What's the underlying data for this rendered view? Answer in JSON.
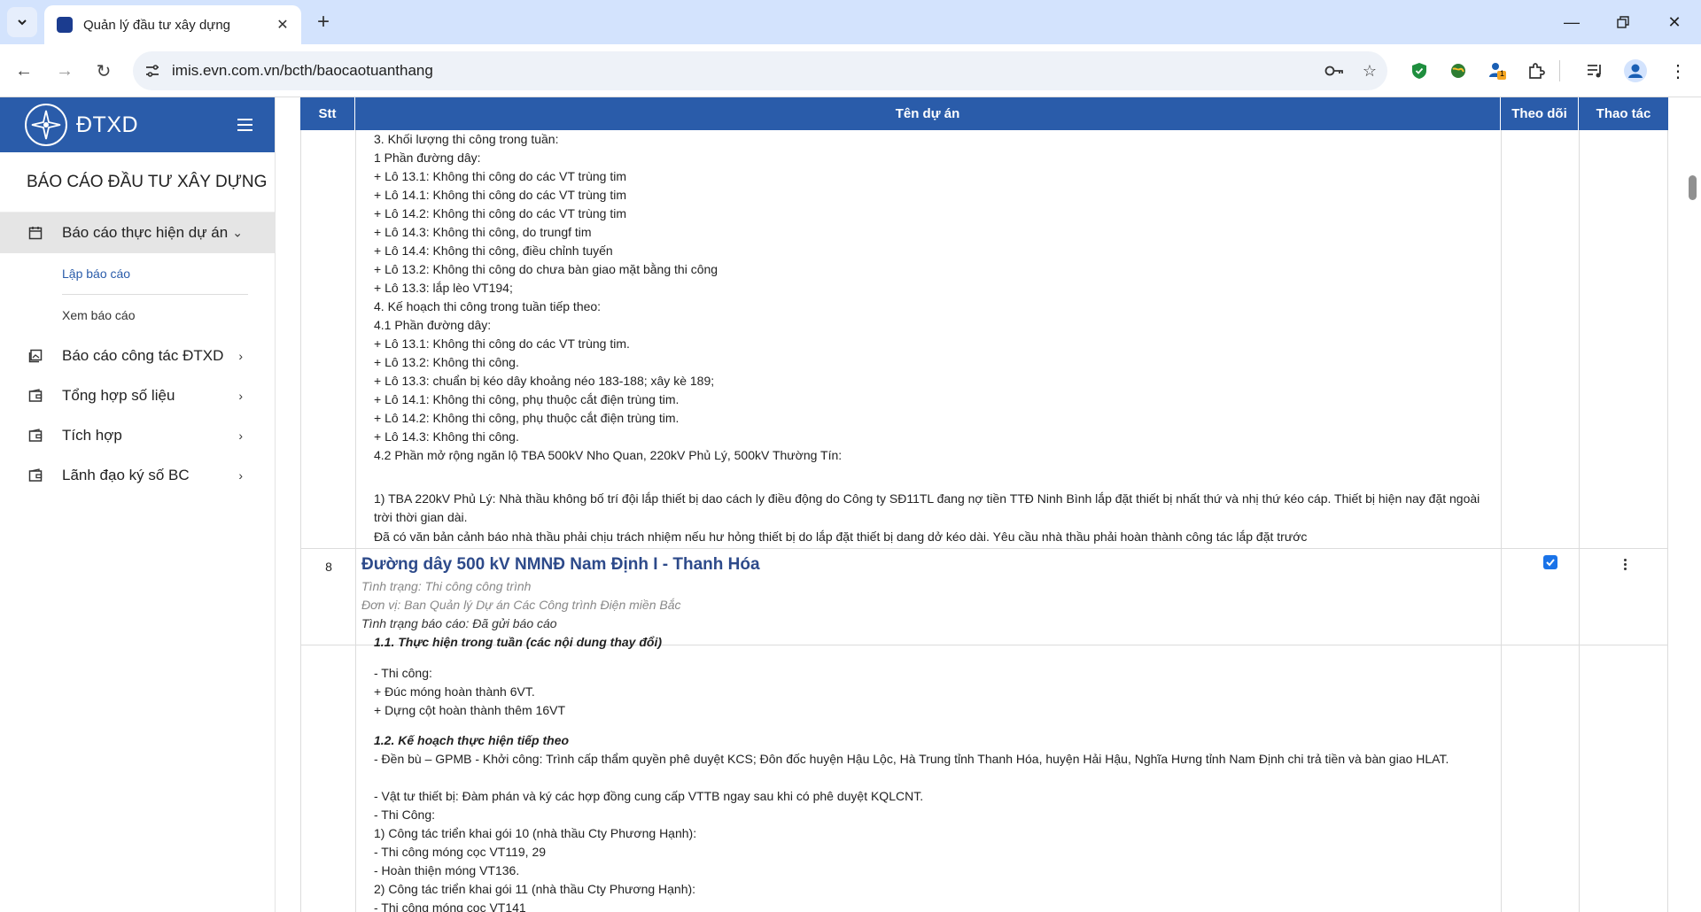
{
  "browser": {
    "tab_title": "Quản lý đầu tư xây dựng",
    "url": "imis.evn.com.vn/bcth/baocaotuanthang",
    "extension_badge": "1"
  },
  "sidebar": {
    "brand": "ĐTXD",
    "title": "BÁO CÁO ĐẦU TƯ XÂY DỰNG",
    "items": [
      {
        "label": "Báo cáo thực hiện dự án",
        "icon": "calendar-icon"
      },
      {
        "label": "Báo cáo công tác ĐTXD",
        "icon": "gallery-icon"
      },
      {
        "label": "Tổng hợp số liệu",
        "icon": "wallet-icon"
      },
      {
        "label": "Tích hợp",
        "icon": "wallet-icon"
      },
      {
        "label": "Lãnh đạo ký số BC",
        "icon": "wallet-icon"
      }
    ],
    "submenu": [
      {
        "label": "Lập báo cáo"
      },
      {
        "label": "Xem báo cáo"
      }
    ]
  },
  "table": {
    "headers": {
      "stt": "Stt",
      "name": "Tên dự án",
      "follow": "Theo dõi",
      "action": "Thao tác"
    },
    "row1_lines": [
      "3. Khối lượng thi công trong tuần:",
      "1 Phần đường dây:",
      "+ Lô 13.1: Không thi công do các VT trùng tim",
      "+ Lô 14.1: Không thi công do các VT trùng tim",
      "+ Lô 14.2: Không thi công do các VT trùng tim",
      "+ Lô 14.3: Không thi công, do trungf tim",
      "+ Lô 14.4: Không thi công, điều chỉnh tuyến",
      "+ Lô 13.2: Không thi công do chưa bàn giao mặt bằng thi công",
      "+ Lô 13.3: lắp lèo VT194;",
      "4. Kế hoạch thi công trong tuần tiếp theo:",
      "4.1 Phần đường dây:",
      "+ Lô 13.1: Không thi công do các VT trùng tim.",
      "+ Lô 13.2: Không thi công.",
      "+ Lô 13.3: chuẩn bị kéo dây khoảng néo 183-188; xây kè 189;",
      "+ Lô 14.1: Không thi công, phụ thuộc cắt điện trùng tim.",
      "+ Lô 14.2: Không thi công, phụ thuộc cắt điện trùng tim.",
      "+ Lô 14.3: Không thi công.",
      "4.2 Phần mở rộng ngăn lộ TBA 500kV Nho Quan, 220kV Phủ Lý, 500kV Thường Tín:"
    ],
    "row1_wrap": "1) TBA 220kV Phủ Lý: Nhà thầu không bố trí đội lắp thiết bị dao cách ly điều động do Công ty SĐ11TL đang nợ tiền TTĐ Ninh Bình lắp đặt thiết bị nhất thứ và nhị thứ kéo cáp. Thiết bị hiện nay đặt ngoài trời thời gian dài.",
    "row1_last": "Đã có văn bản cảnh báo nhà thầu phải chịu trách nhiệm nếu hư hỏng thiết bị do lắp đặt thiết bị dang dở kéo dài. Yêu cầu nhà thầu phải hoàn thành công tác lắp đặt trước",
    "row2": {
      "stt": "8",
      "title": "Đường dây 500 kV NMNĐ Nam Định I - Thanh Hóa",
      "status": "Tình trạng: Thi công công trình",
      "unit": "Đơn vị: Ban Quản lý Dự án Các Công trình Điện miền Bắc",
      "report_status": "Tình trạng báo cáo: Đã gửi báo cáo",
      "section1": "1.1. Thực hiện trong tuần (các nội dung thay đổi)",
      "lines_a": [
        "- Thi công:",
        "+ Đúc móng hoàn thành 6VT.",
        "+ Dựng cột hoàn thành thêm 16VT"
      ],
      "section2": "1.2. Kế hoạch thực hiện tiếp theo",
      "wrap_b": "- Đền bù – GPMB - Khởi công: Trình cấp thẩm quyền phê duyệt KCS; Đôn đốc huyện Hậu Lộc, Hà Trung tỉnh Thanh Hóa, huyện Hải Hậu, Nghĩa Hưng tỉnh Nam Định chi trả tiền và bàn giao HLAT.",
      "lines_c": [
        "- Vật tư thiết bị: Đàm phán và ký các hợp đồng cung cấp VTTB ngay sau khi có phê duyệt KQLCNT.",
        "- Thi Công:",
        "1) Công tác triển khai gói 10 (nhà thầu Cty Phương Hạnh):",
        "- Thi công móng cọc VT119, 29",
        "- Hoàn thiện móng VT136.",
        "2) Công tác triển khai gói 11 (nhà thầu Cty Phương Hạnh):",
        "- Thi công móng cọc VT141"
      ]
    }
  }
}
